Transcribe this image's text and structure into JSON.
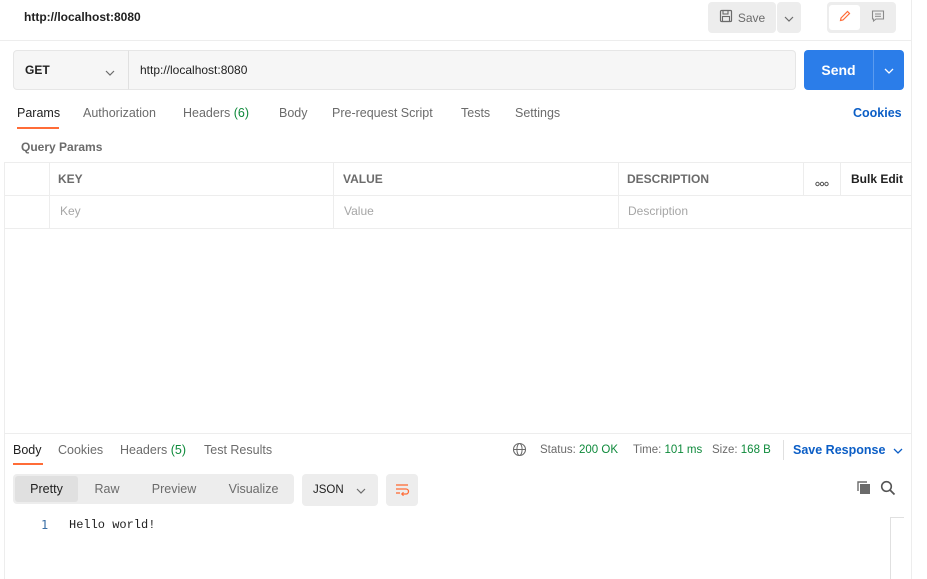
{
  "request": {
    "title": "http://localhost:8080",
    "save_label": "Save",
    "method": "GET",
    "url": "http://localhost:8080",
    "send_label": "Send"
  },
  "request_tabs": [
    {
      "label": "Params",
      "count": ""
    },
    {
      "label": "Authorization",
      "count": ""
    },
    {
      "label": "Headers",
      "count": "(6)"
    },
    {
      "label": "Body",
      "count": ""
    },
    {
      "label": "Pre-request Script",
      "count": ""
    },
    {
      "label": "Tests",
      "count": ""
    },
    {
      "label": "Settings",
      "count": ""
    }
  ],
  "cookies_label": "Cookies",
  "params": {
    "section_title": "Query Params",
    "columns": [
      "KEY",
      "VALUE",
      "DESCRIPTION"
    ],
    "placeholders": {
      "key": "Key",
      "value": "Value",
      "description": "Description"
    },
    "bulk_edit_label": "Bulk Edit"
  },
  "response": {
    "tabs": [
      {
        "label": "Body",
        "count": ""
      },
      {
        "label": "Cookies",
        "count": ""
      },
      {
        "label": "Headers",
        "count": "(5)"
      },
      {
        "label": "Test Results",
        "count": ""
      }
    ],
    "status_label": "Status:",
    "status_value": "200 OK",
    "time_label": "Time:",
    "time_value": "101 ms",
    "size_label": "Size:",
    "size_value": "168 B",
    "save_response_label": "Save Response",
    "view_modes": [
      "Pretty",
      "Raw",
      "Preview",
      "Visualize"
    ],
    "format": "JSON",
    "lines": [
      {
        "num": "1",
        "text": "Hello world!"
      }
    ]
  },
  "colors": {
    "accent": "#ff6c37",
    "primary": "#2b7de9",
    "link": "#0b5ec6",
    "success": "#0e8a3b"
  },
  "icons": [
    "save-icon",
    "chevron-down-icon",
    "pencil-icon",
    "comment-icon",
    "more-icon",
    "globe-icon",
    "wrap-lines-icon",
    "copy-icon",
    "search-icon"
  ]
}
